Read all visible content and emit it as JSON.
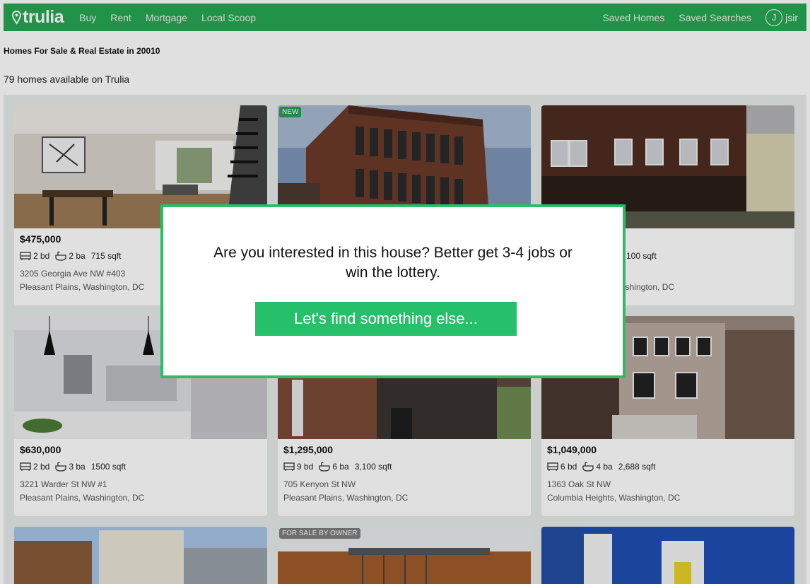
{
  "header": {
    "logo": "trulia",
    "nav": [
      "Buy",
      "Rent",
      "Mortgage",
      "Local Scoop"
    ],
    "right_nav": [
      "Saved Homes",
      "Saved Searches"
    ],
    "user_initial": "J",
    "user_name": "jsir"
  },
  "page_title": "Homes For Sale & Real Estate in 20010",
  "count": "79 homes available on Trulia",
  "cards": [
    {
      "tag": "",
      "price": "$475,000",
      "beds": "2 bd",
      "baths": "2 ba",
      "sqft": "715 sqft",
      "address": "3205 Georgia Ave NW #403",
      "neighborhood": "Pleasant Plains, Washington, DC"
    },
    {
      "tag": "NEW",
      "price": "",
      "beds": "",
      "baths": "",
      "sqft": "",
      "address": "",
      "neighborhood": ""
    },
    {
      "tag": "",
      "price": "",
      "beds": "",
      "baths": "",
      "sqft": "100 sqft",
      "address": "",
      "neighborhood": "ashington, DC"
    },
    {
      "tag": "",
      "price": "$630,000",
      "beds": "2 bd",
      "baths": "3 ba",
      "sqft": "1500 sqft",
      "address": "3221 Warder St NW #1",
      "neighborhood": "Pleasant Plains, Washington, DC"
    },
    {
      "tag": "",
      "price": "$1,295,000",
      "beds": "9 bd",
      "baths": "6 ba",
      "sqft": "3,100 sqft",
      "address": "705 Kenyon St NW",
      "neighborhood": "Pleasant Plains, Washington, DC"
    },
    {
      "tag": "",
      "price": "$1,049,000",
      "beds": "6 bd",
      "baths": "4 ba",
      "sqft": "2,688 sqft",
      "address": "1363 Oak St NW",
      "neighborhood": "Columbia Heights, Washington, DC"
    },
    {
      "tag": ""
    },
    {
      "tag": "FOR SALE BY OWNER"
    },
    {
      "tag": ""
    }
  ],
  "modal": {
    "message": "Are you interested in this house? Better get 3-4 jobs or win the lottery.",
    "button": "Let's find something else..."
  },
  "colors": {
    "brand": "#26a853",
    "modal_border": "#2cbd67",
    "button": "#26c06a"
  }
}
